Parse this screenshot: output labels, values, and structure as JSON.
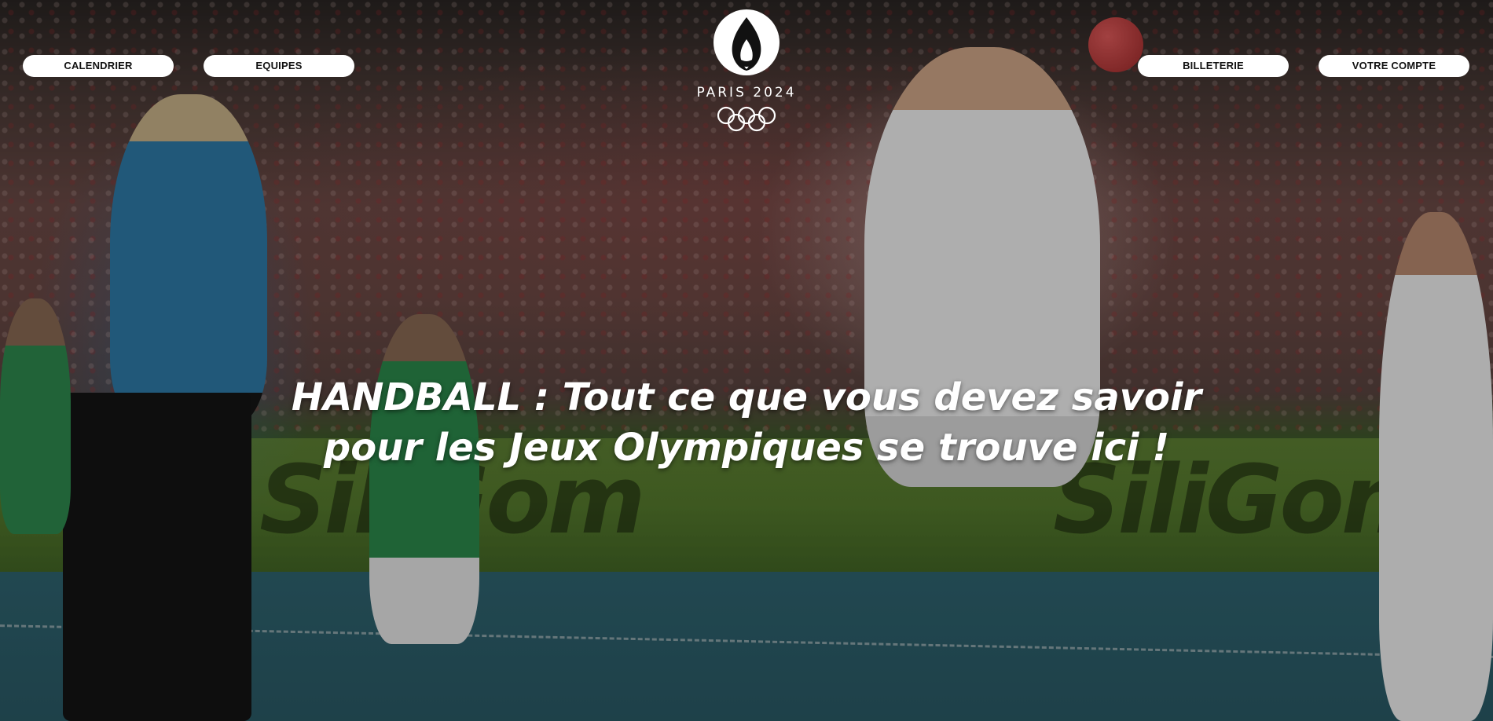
{
  "nav": {
    "left": [
      {
        "label": "CALENDRIER"
      },
      {
        "label": "EQUIPES"
      }
    ],
    "right": [
      {
        "label": "BILLETERIE"
      },
      {
        "label": "VOTRE COMPTE"
      }
    ]
  },
  "logo": {
    "text": "PARIS 2024",
    "icon": "olympic-flame-icon",
    "rings_icon": "olympic-rings-icon"
  },
  "hero": {
    "headline": "HANDBALL : Tout ce que vous devez savoir pour les Jeux Olympiques se trouve ici !",
    "background": "handball-arena-photo"
  },
  "colors": {
    "button_bg": "#ffffff",
    "button_text": "#111111",
    "headline": "#ffffff"
  }
}
